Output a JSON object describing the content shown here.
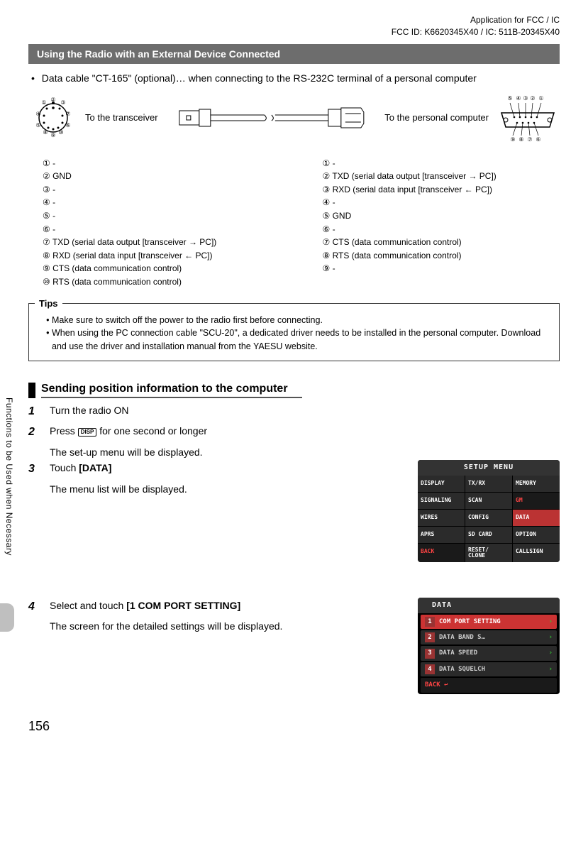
{
  "header": {
    "line1": "Application for FCC / IC",
    "line2": "FCC ID: K6620345X40 / IC: 511B-20345X40"
  },
  "section_bar": "Using the Radio with an External Device Connected",
  "intro_bullet": "Data cable \"CT-165\" (optional)… when connecting to the RS-232C terminal of a personal computer",
  "cable": {
    "left_label": "To the transceiver",
    "right_label": "To the personal computer"
  },
  "pins_left": {
    "1": "-",
    "2": "GND",
    "3": "-",
    "4": "-",
    "5": "-",
    "6": "-",
    "7": "TXD (serial data output [transceiver → PC])",
    "8": "RXD (serial data input [transceiver ← PC])",
    "9": "CTS (data communication control)",
    "10": "RTS (data communication control)"
  },
  "pins_right": {
    "1": "-",
    "2": "TXD (serial data output [transceiver → PC])",
    "3": "RXD (serial data input [transceiver ← PC])",
    "4": "-",
    "5": "GND",
    "6": "-",
    "7": "CTS (data communication control)",
    "8": "RTS (data communication control)",
    "9": "-"
  },
  "tips": {
    "label": "Tips",
    "item1": "Make sure to switch off the power to the radio first before connecting.",
    "item2": "When using the PC connection cable \"SCU-20\", a dedicated driver needs to be installed in the personal computer. Download and use the driver and installation manual from the YAESU website."
  },
  "subsection": "Sending position information to the computer",
  "steps": {
    "s1": {
      "num": "1",
      "body": "Turn the radio ON"
    },
    "s2": {
      "num": "2",
      "body_pre": "Press ",
      "key": "DISP",
      "body_post": " for one second or longer",
      "sub": "The set-up menu will be displayed."
    },
    "s3": {
      "num": "3",
      "body_pre": "Touch ",
      "bold": "[DATA]",
      "sub": "The menu list will be displayed."
    },
    "s4": {
      "num": "4",
      "body_pre": "Select and touch ",
      "bold": "[1 COM PORT SETTING]",
      "sub": "The screen for the detailed settings will be displayed."
    }
  },
  "setup_menu": {
    "title": "SETUP MENU",
    "cells": [
      "DISPLAY",
      "TX/RX",
      "MEMORY",
      "SIGNALING",
      "SCAN",
      "GM",
      "WIRES",
      "CONFIG",
      "DATA",
      "APRS",
      "SD CARD",
      "OPTION",
      "BACK",
      "RESET/\nCLONE",
      "CALLSIGN"
    ]
  },
  "data_menu": {
    "title": "DATA",
    "rows": [
      {
        "n": "1",
        "t": "COM PORT SETTING",
        "sel": true
      },
      {
        "n": "2",
        "t": "DATA BAND S…",
        "sel": false
      },
      {
        "n": "3",
        "t": "DATA SPEED",
        "sel": false
      },
      {
        "n": "4",
        "t": "DATA SQUELCH",
        "sel": false
      }
    ],
    "back": "BACK"
  },
  "side_tab": "Functions to be Used when Necessary",
  "page": "156"
}
